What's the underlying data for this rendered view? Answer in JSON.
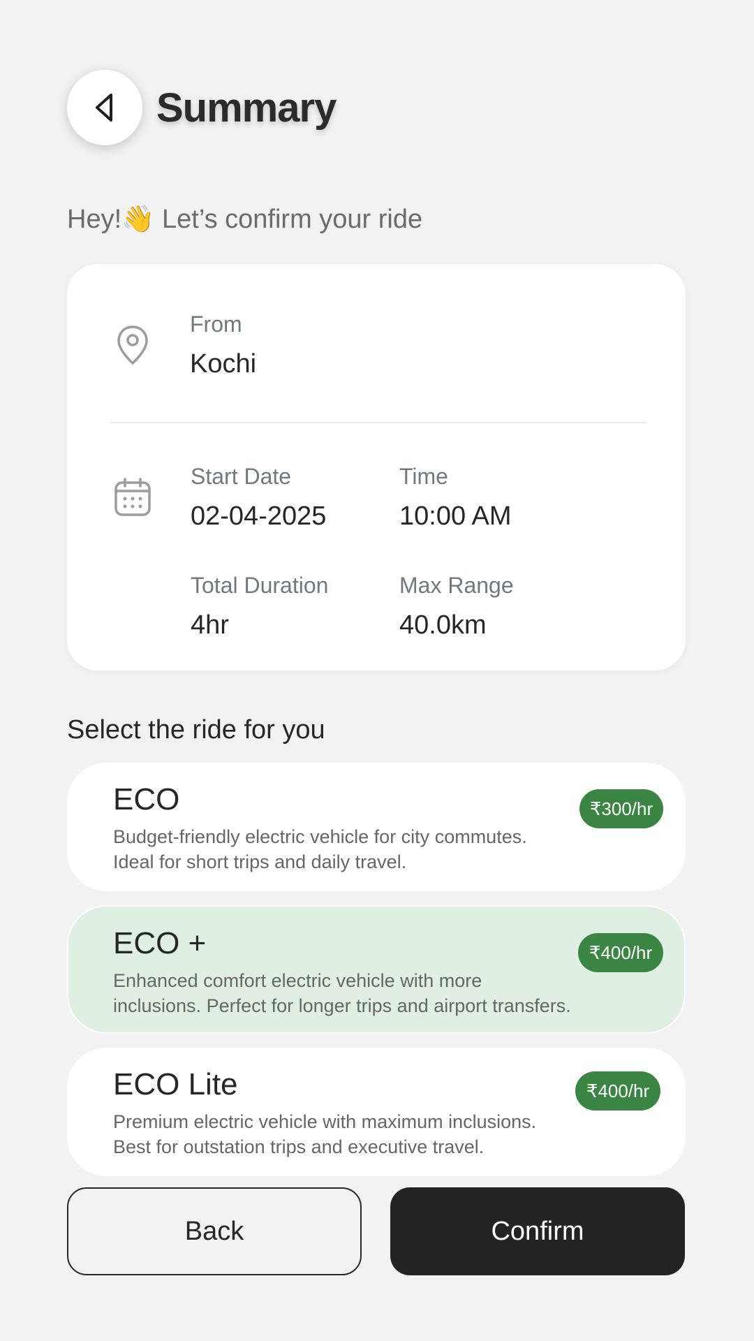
{
  "header": {
    "title": "Summary"
  },
  "greeting": "Hey!👋 Let’s confirm your ride",
  "summary": {
    "from_label": "From",
    "from_value": "Kochi",
    "start_date_label": "Start Date",
    "start_date_value": "02-04-2025",
    "time_label": "Time",
    "time_value": "10:00 AM",
    "duration_label": "Total Duration",
    "duration_value": "4hr",
    "range_label": "Max Range",
    "range_value": "40.0km"
  },
  "rides_heading": "Select the ride for you",
  "rides": [
    {
      "name": "ECO",
      "price": "₹300/hr",
      "desc_line1": "Budget-friendly electric vehicle for city commutes.",
      "desc_line2": "Ideal for short trips and daily travel."
    },
    {
      "name": "ECO +",
      "price": "₹400/hr",
      "desc_line1": "Enhanced comfort electric vehicle with more",
      "desc_line2": "inclusions. Perfect for longer trips and airport transfers."
    },
    {
      "name": "ECO Lite",
      "price": "₹400/hr",
      "desc_line1": "Premium electric vehicle with maximum inclusions.",
      "desc_line2": "Best for outstation trips and executive travel."
    }
  ],
  "selected_ride": "ECO +",
  "buttons": {
    "back": "Back",
    "confirm": "Confirm"
  },
  "colors": {
    "background": "#f2f2f2",
    "price_badge": "#3a8544",
    "selected_card": "#dff0e2",
    "confirm_button": "#232323"
  },
  "icons": {
    "back": "chevron-left-icon",
    "location": "location-pin-icon",
    "calendar": "calendar-icon"
  }
}
